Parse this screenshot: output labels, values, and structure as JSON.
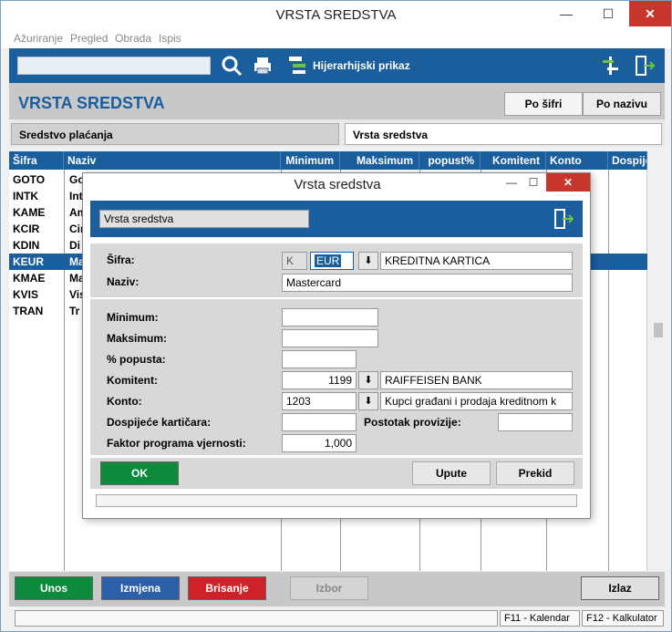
{
  "window": {
    "title": "VRSTA SREDSTVA",
    "minimize": "—",
    "maximize": "☐",
    "close": "✕"
  },
  "menu": [
    "Ažuriranje",
    "Pregled",
    "Obrada",
    "Ispis"
  ],
  "toolbar": {
    "search_placeholder": "",
    "hierarchy_label": "Hijerarhijski prikaz"
  },
  "header": {
    "title": "VRSTA SREDSTVA",
    "sort_by_code": "Po šifri",
    "sort_by_name": "Po nazivu"
  },
  "tabs": [
    "Sredstvo plaćanja",
    "Vrsta sredstva"
  ],
  "grid": {
    "columns": [
      "Šifra",
      "Naziv",
      "Minimum",
      "Maksimum",
      "popust%",
      "Komitent",
      "Konto",
      "Dospije"
    ],
    "rows": [
      {
        "code": "GOTO",
        "name": "Go"
      },
      {
        "code": "INTK",
        "name": "Int"
      },
      {
        "code": "KAME",
        "name": "Am"
      },
      {
        "code": "KCIR",
        "name": "Cir"
      },
      {
        "code": "KDIN",
        "name": "Di"
      },
      {
        "code": "KEUR",
        "name": "Ma"
      },
      {
        "code": "KMAE",
        "name": "Ma"
      },
      {
        "code": "KVIS",
        "name": "Vis"
      },
      {
        "code": "TRAN",
        "name": "Tr"
      }
    ],
    "selected_index": 5
  },
  "bottom": {
    "new": "Unos",
    "edit": "Izmjena",
    "delete": "Brisanje",
    "select": "Izbor",
    "exit": "Izlaz"
  },
  "status": {
    "f11": "F11 - Kalendar",
    "f12": "F12 - Kalkulator"
  },
  "dialog": {
    "title": "Vrsta sredstva",
    "name_box": "Vrsta sredstva",
    "labels": {
      "code": "Šifra:",
      "name": "Naziv:",
      "minimum": "Minimum:",
      "maximum": "Maksimum:",
      "discount": "% popusta:",
      "partner": "Komitent:",
      "account": "Konto:",
      "card_due": "Dospijeće kartičara:",
      "commission": "Postotak provizije:",
      "loyalty": "Faktor programa vjernosti:"
    },
    "values": {
      "code_prefix": "K",
      "code": "EUR",
      "code_desc": "KREDITNA KARTICA",
      "name": "Mastercard",
      "minimum": "",
      "maximum": "",
      "discount": "",
      "partner": "1199",
      "partner_name": "RAIFFEISEN BANK",
      "account": "1203",
      "account_name": "Kupci građani i prodaja kreditnom k",
      "card_due": "",
      "commission": "",
      "loyalty": "1,000"
    },
    "buttons": {
      "ok": "OK",
      "help": "Upute",
      "cancel": "Prekid"
    }
  },
  "colors": {
    "accent": "#1b5e9e",
    "ok": "#0e8a3c",
    "new": "#0e8a3c",
    "edit": "#2b60a8",
    "delete": "#d0202a",
    "close": "#c7352b"
  }
}
